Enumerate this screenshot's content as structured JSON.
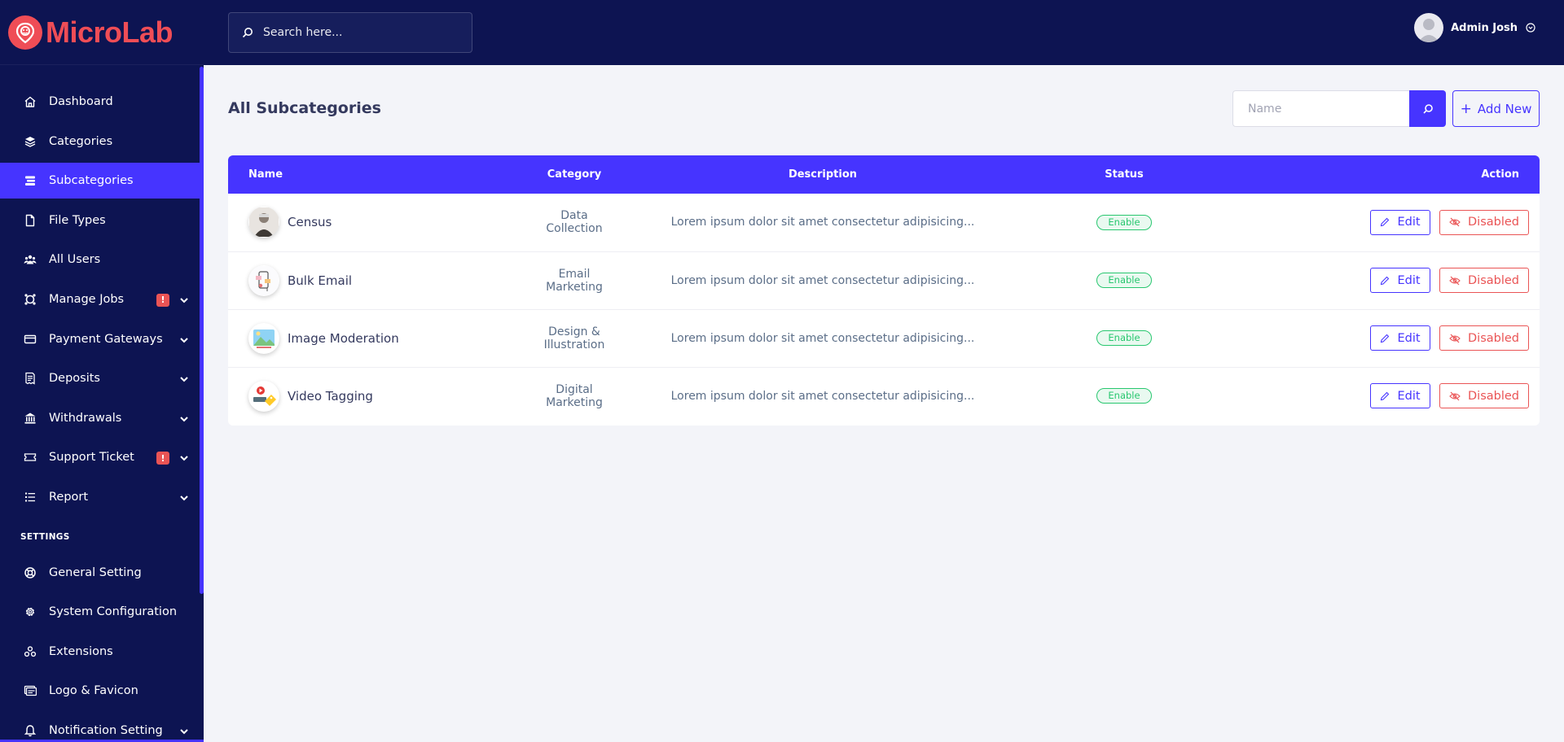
{
  "brand": {
    "name": "MicroLab"
  },
  "topbar": {
    "search_placeholder": "Search here...",
    "user_name": "Admin Josh"
  },
  "sidebar": {
    "items": [
      {
        "label": "Dashboard",
        "icon": "home-icon"
      },
      {
        "label": "Categories",
        "icon": "layers-icon"
      },
      {
        "label": "Subcategories",
        "icon": "stack-icon",
        "active": true
      },
      {
        "label": "File Types",
        "icon": "file-icon"
      },
      {
        "label": "All Users",
        "icon": "users-icon"
      },
      {
        "label": "Manage Jobs",
        "icon": "jobs-icon",
        "badge": "!",
        "has_submenu": true
      },
      {
        "label": "Payment Gateways",
        "icon": "credit-card-icon",
        "has_submenu": true
      },
      {
        "label": "Deposits",
        "icon": "receipt-icon",
        "has_submenu": true
      },
      {
        "label": "Withdrawals",
        "icon": "bank-icon",
        "has_submenu": true
      },
      {
        "label": "Support Ticket",
        "icon": "ticket-icon",
        "badge": "!",
        "has_submenu": true
      },
      {
        "label": "Report",
        "icon": "list-icon",
        "has_submenu": true
      }
    ],
    "settings_heading": "SETTINGS",
    "settings_items": [
      {
        "label": "General Setting",
        "icon": "life-ring-icon"
      },
      {
        "label": "System Configuration",
        "icon": "gear-icon"
      },
      {
        "label": "Extensions",
        "icon": "cubes-icon"
      },
      {
        "label": "Logo & Favicon",
        "icon": "image-icon"
      },
      {
        "label": "Notification Setting",
        "icon": "bell-icon",
        "has_submenu": true
      }
    ]
  },
  "main": {
    "title": "All Subcategories",
    "filter_placeholder": "Name",
    "add_new_label": "Add New"
  },
  "table": {
    "columns": [
      "Name",
      "Category",
      "Description",
      "Status",
      "Action"
    ],
    "rows": [
      {
        "name": "Census",
        "category": "Data Collection",
        "description": "Lorem ipsum dolor sit amet consectetur adipisicing...",
        "status": "Enable",
        "thumb": "census"
      },
      {
        "name": "Bulk Email",
        "category": "Email Marketing",
        "description": "Lorem ipsum dolor sit amet consectetur adipisicing...",
        "status": "Enable",
        "thumb": "email"
      },
      {
        "name": "Image Moderation",
        "category": "Design & Illustration",
        "description": "Lorem ipsum dolor sit amet consectetur adipisicing...",
        "status": "Enable",
        "thumb": "image"
      },
      {
        "name": "Video Tagging",
        "category": "Digital Marketing",
        "description": "Lorem ipsum dolor sit amet consectetur adipisicing...",
        "status": "Enable",
        "thumb": "video"
      }
    ],
    "edit_label": "Edit",
    "disable_label": "Disabled"
  },
  "colors": {
    "sidebar_bg": "#0d1452",
    "accent": "#4634ff",
    "brand": "#ef4d56",
    "success": "#28c76f",
    "danger": "#ea5455"
  }
}
